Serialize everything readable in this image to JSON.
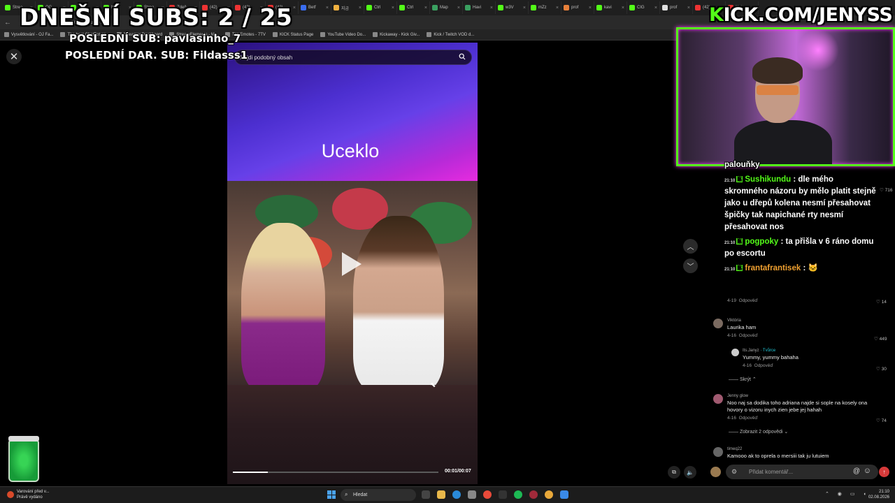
{
  "overlay": {
    "subs_counter": "DNEŠNÍ SUBS: 2 / 25",
    "last_sub": "POSLEDNÍ SUB: pavlasinho_7",
    "last_gift_sub": "POSLEDNÍ DAR. SUB: Fildasss1",
    "kick_url_k": "K",
    "kick_url_rest": "ICK.COM/JENYSS"
  },
  "browser": {
    "tabs": [
      {
        "label": "Strea",
        "color": "#53fc18"
      },
      {
        "label": "OG",
        "color": "#53fc18"
      },
      {
        "label": "Live",
        "color": "#53fc18"
      },
      {
        "label": "Neli",
        "color": "#53fc18"
      },
      {
        "label": "Strea",
        "color": "#53fc18"
      },
      {
        "label": "Zdeň",
        "color": "#e33"
      },
      {
        "label": "(42)",
        "color": "#e33"
      },
      {
        "label": "(42)",
        "color": "#e33"
      },
      {
        "label": "(42)",
        "color": "#e33"
      },
      {
        "label": "Betf",
        "color": "#3a6df0"
      },
      {
        "label": "지금",
        "color": "#f0b040"
      },
      {
        "label": "Ctrl",
        "color": "#53fc18"
      },
      {
        "label": "Ctrl",
        "color": "#53fc18"
      },
      {
        "label": "Map",
        "color": "#3aa060"
      },
      {
        "label": "Havi",
        "color": "#3aa060"
      },
      {
        "label": "w3V",
        "color": "#53fc18"
      },
      {
        "label": "mZz",
        "color": "#53fc18"
      },
      {
        "label": "prof",
        "color": "#e8803a"
      },
      {
        "label": "kavi",
        "color": "#53fc18"
      },
      {
        "label": "CIG",
        "color": "#53fc18"
      },
      {
        "label": "prof",
        "color": "#ddd"
      },
      {
        "label": "(42)",
        "color": "#e33"
      },
      {
        "label": "Naj",
        "color": "#e33"
      }
    ],
    "address": "/762...estu&t=...",
    "bookmarks": [
      "Vysvětlování - OJ Fa...",
      "The best ChatBot an...",
      "Streamer Dashboard",
      "StreamElements - M...",
      "Top Emotes - 7TV",
      "KICK Status Page",
      "YouTube Video Do...",
      "Kickaway - Kick Giv...",
      "Kick / Twitch VOD d..."
    ]
  },
  "video": {
    "search_placeholder": "Najdi podobný obsah",
    "title": "Uceklo",
    "time": "00:01/00:07",
    "progress": 0.17
  },
  "chat_overlay": [
    {
      "time": "",
      "user": "",
      "text": "palouňky"
    },
    {
      "time": "21:10",
      "user": "Sushikundu",
      "text": ": dle mého"
    },
    {
      "time": "",
      "user": "",
      "text": "skromného názoru by mělo platit stejně"
    },
    {
      "time": "",
      "user": "",
      "text": "jako u dřepů kolena nesmí přesahovat"
    },
    {
      "time": "",
      "user": "",
      "text": "špičky tak napichané rty nesmí"
    },
    {
      "time": "",
      "user": "",
      "text": "přesahovat nos"
    },
    {
      "time": "21:10",
      "user": "pogpoky",
      "text": ": ta přišla v 6 ráno domu"
    },
    {
      "time": "",
      "user": "",
      "text": "po escortu"
    },
    {
      "time": "21:10",
      "user": "frantafrantisek",
      "text": ":"
    }
  ],
  "comments": [
    {
      "name": "",
      "text": "",
      "date": "4-19",
      "reply": "Odpověď",
      "likes": "14"
    },
    {
      "name": "Viktória",
      "text": "Laurika ham",
      "date": "4-16",
      "reply": "Odpověď",
      "likes": "449"
    },
    {
      "name": "Its.Janyz",
      "creator": "· Tvůrce",
      "text": "Yummy, yummy bahaha",
      "date": "4-16",
      "reply": "Odpověď",
      "likes": "30"
    },
    {
      "name": "Jenny glow",
      "text": "Noo naj sa dodika toho adriana najde si sople na kosely ona hovory o vizoru inych zien jebe jej hahah",
      "date": "4-16",
      "reply": "Odpověď",
      "likes": "74"
    },
    {
      "name": "timeq22",
      "text": "Kamooo ak to oprela o mersiii tak ju lutuiem",
      "date": "",
      "reply": "",
      "likes": ""
    }
  ],
  "comment_likes_top": "716",
  "hide_replies": "Skrýt",
  "show_replies": "Zobrazit 2 odpovědi",
  "comment_input_placeholder": "Přidat komentář...",
  "taskbar": {
    "warning_title": "Varování před v...",
    "warning_sub": "Právě vydáno",
    "search": "Hledat",
    "time": "21:10",
    "date": "02.08.2026"
  },
  "colors": {
    "kick_green": "#53fc18",
    "accent_pink": "#ff3dff"
  }
}
